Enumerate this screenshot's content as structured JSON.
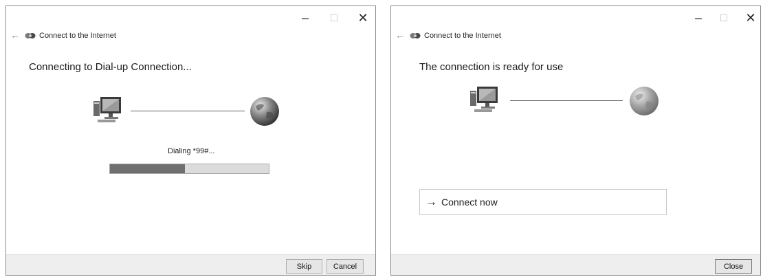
{
  "left_window": {
    "caption": {
      "minimize": "–",
      "maximize": "☐",
      "close": "✕"
    },
    "nav": {
      "back": "←",
      "title": "Connect to the Internet",
      "icon": "network-connection-icon"
    },
    "heading": "Connecting to Dial-up Connection...",
    "graphic": {
      "left_icon": "computer-icon",
      "right_icon": "globe-icon"
    },
    "status": "Dialing *99#...",
    "progress": 0.47,
    "buttons": {
      "skip": "Skip",
      "cancel": "Cancel"
    }
  },
  "right_window": {
    "caption": {
      "minimize": "–",
      "maximize": "☐",
      "close": "✕"
    },
    "nav": {
      "back": "←",
      "title": "Connect to the Internet",
      "icon": "network-connection-icon"
    },
    "heading": "The connection is ready for use",
    "graphic": {
      "left_icon": "computer-icon",
      "right_icon": "globe-icon"
    },
    "command_link": {
      "arrow": "→",
      "label": "Connect now"
    },
    "buttons": {
      "close": "Close"
    }
  }
}
